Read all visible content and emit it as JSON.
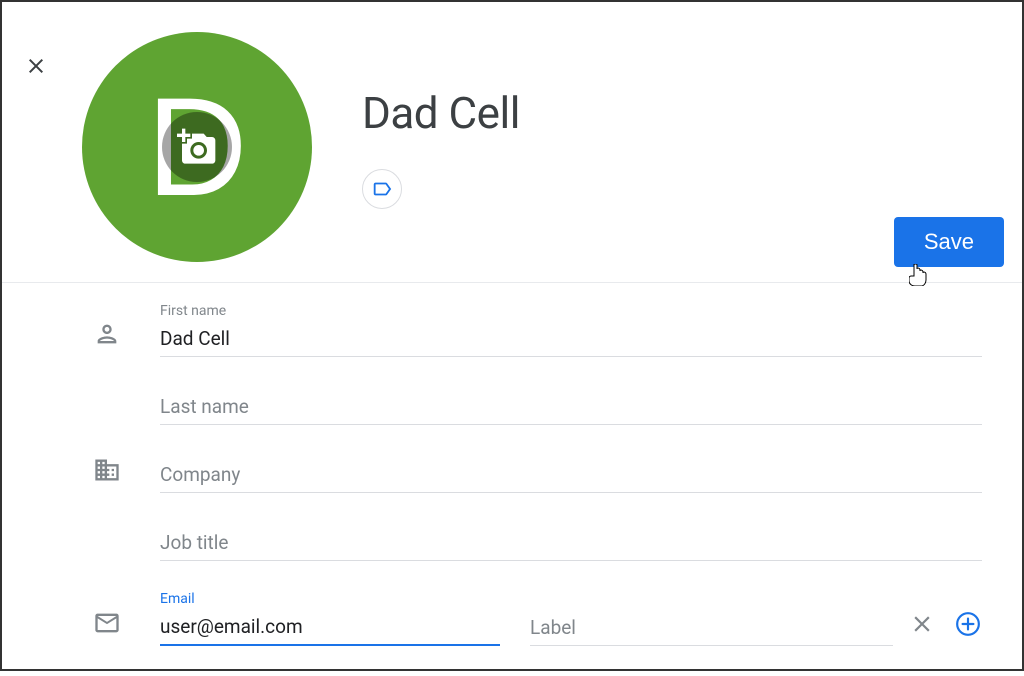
{
  "contact_name": "Dad Cell",
  "avatar_letter": "D",
  "save_label": "Save",
  "fields": {
    "first_name": {
      "label": "First name",
      "value": "Dad Cell"
    },
    "last_name": {
      "placeholder": "Last name",
      "value": ""
    },
    "company": {
      "placeholder": "Company",
      "value": ""
    },
    "job_title": {
      "placeholder": "Job title",
      "value": ""
    },
    "email": {
      "label": "Email",
      "value": "user@email.com"
    },
    "email_label": {
      "placeholder": "Label",
      "value": ""
    }
  },
  "colors": {
    "avatar_bg": "#5fa432",
    "primary": "#1a73e8",
    "icon_gray": "#80868b"
  }
}
